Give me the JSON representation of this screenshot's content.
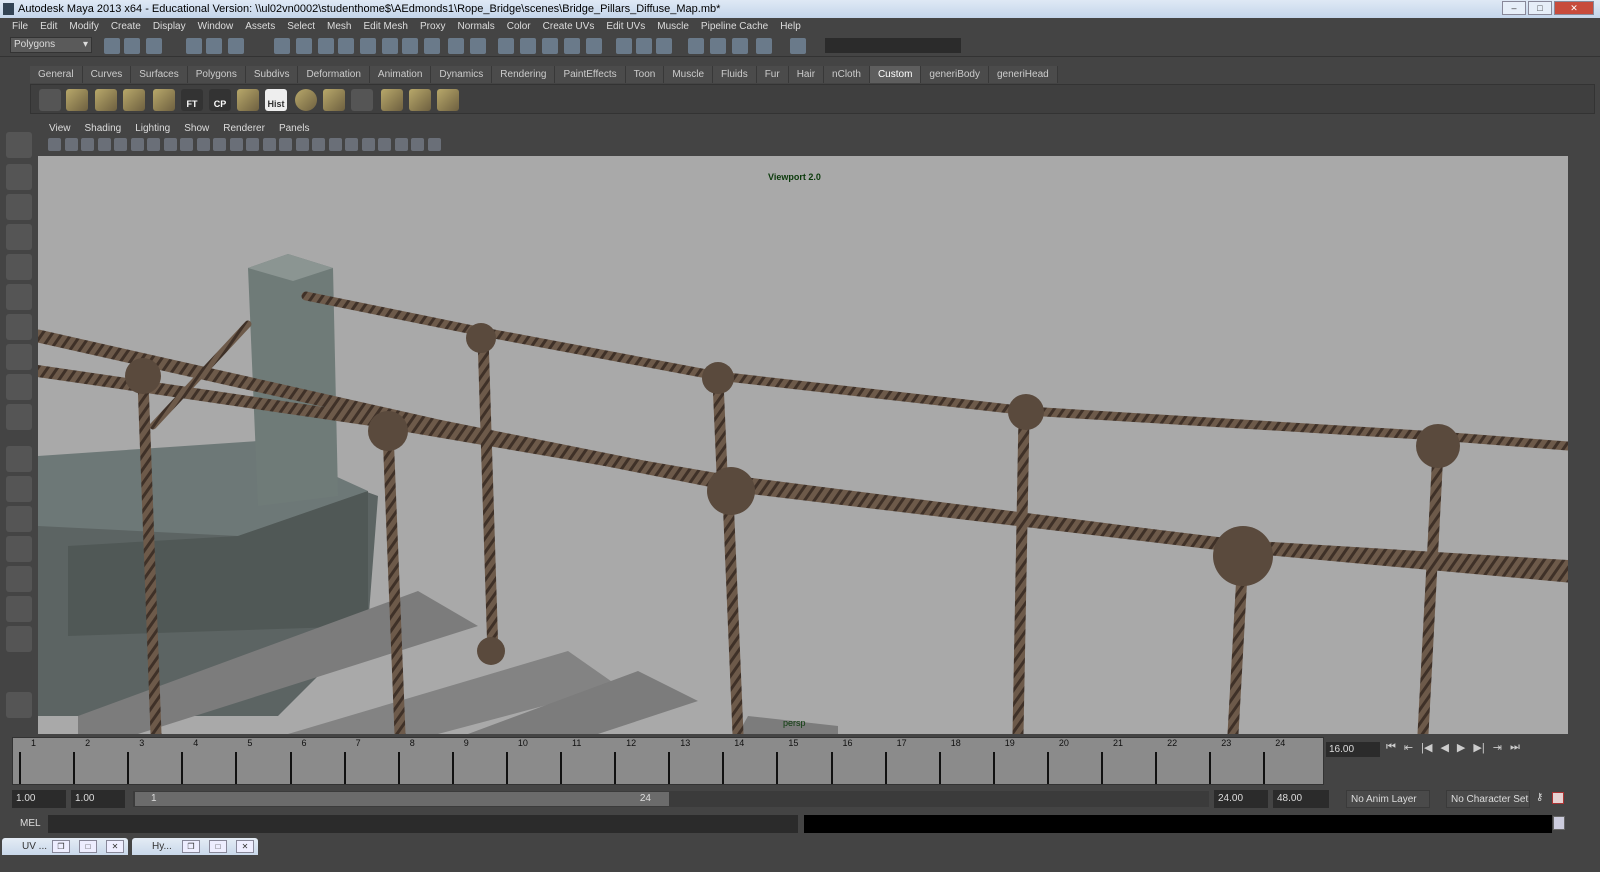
{
  "window": {
    "title": "Autodesk Maya 2013 x64 - Educational Version: \\\\ul02vn0002\\studenthome$\\AEdmonds1\\Rope_Bridge\\scenes\\Bridge_Pillars_Diffuse_Map.mb*",
    "minimize": "–",
    "maximize": "□",
    "close": "✕"
  },
  "menu": [
    "File",
    "Edit",
    "Modify",
    "Create",
    "Display",
    "Window",
    "Assets",
    "Select",
    "Mesh",
    "Edit Mesh",
    "Proxy",
    "Normals",
    "Color",
    "Create UVs",
    "Edit UVs",
    "Muscle",
    "Pipeline Cache",
    "Help"
  ],
  "toolbar": {
    "menu_set": "Polygons"
  },
  "shelf": {
    "tabs": [
      "General",
      "Curves",
      "Surfaces",
      "Polygons",
      "Subdivs",
      "Deformation",
      "Animation",
      "Dynamics",
      "Rendering",
      "PaintEffects",
      "Toon",
      "Muscle",
      "Fluids",
      "Fur",
      "Hair",
      "nCloth",
      "Custom",
      "generiBody",
      "generiHead"
    ],
    "active": "Custom",
    "labels": {
      "ft": "FT",
      "cp": "CP",
      "hist": "Hist"
    }
  },
  "panel": {
    "menu": [
      "View",
      "Shading",
      "Lighting",
      "Show",
      "Renderer",
      "Panels"
    ],
    "renderer_label": "Viewport 2.0",
    "camera": "persp"
  },
  "timeline": {
    "ticks": [
      "1",
      "2",
      "3",
      "4",
      "5",
      "6",
      "7",
      "8",
      "9",
      "10",
      "11",
      "12",
      "13",
      "14",
      "15",
      "16",
      "17",
      "18",
      "19",
      "20",
      "21",
      "22",
      "23",
      "24"
    ],
    "current_time": "16.00",
    "playback": [
      "⏮",
      "⇤",
      "|◀",
      "◀",
      "▶",
      "▶|",
      "⇥",
      "⏭"
    ]
  },
  "range": {
    "start": "1.00",
    "playback_start": "1.00",
    "slider_start": "1",
    "slider_end": "24",
    "playback_end": "24.00",
    "end": "48.00",
    "anim_layer": "No Anim Layer",
    "character_set": "No Character Set"
  },
  "mel": {
    "label": "MEL"
  },
  "taskbar": [
    {
      "label": "UV ..."
    },
    {
      "label": "Hy..."
    }
  ]
}
